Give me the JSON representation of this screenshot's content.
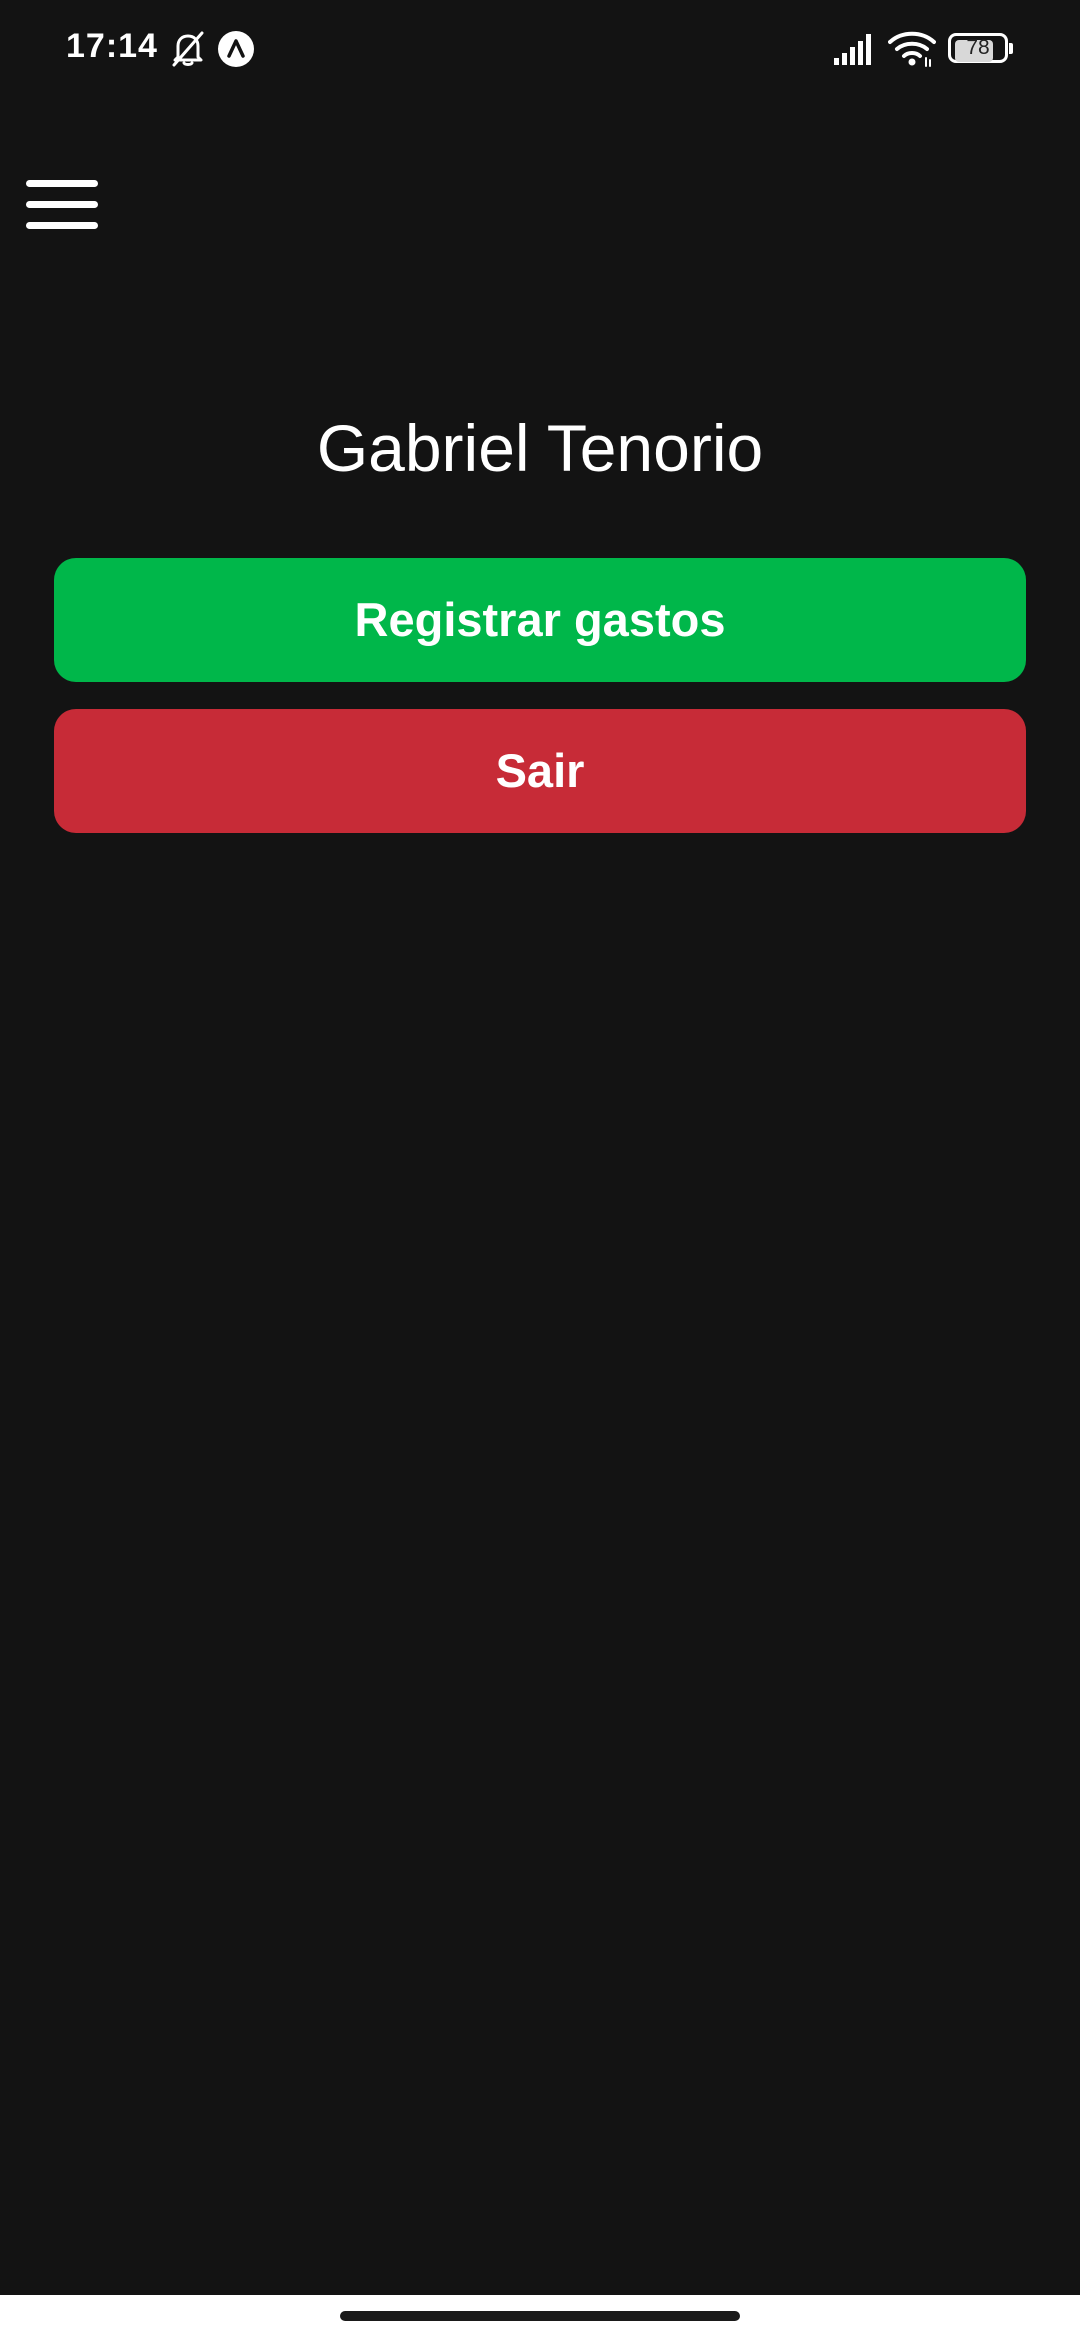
{
  "status_bar": {
    "time": "17:14",
    "battery_level": "78",
    "icons": [
      "bell-off-icon",
      "expo-icon",
      "signal-icon",
      "wifi-icon",
      "battery-icon"
    ]
  },
  "header": {
    "menu_icon": "hamburger-menu-icon"
  },
  "profile": {
    "name": "Gabriel Tenorio"
  },
  "actions": {
    "register_label": "Registrar gastos",
    "logout_label": "Sair"
  },
  "colors": {
    "background": "#131313",
    "register_button": "#00b74a",
    "logout_button": "#c72b37",
    "text": "#ffffff"
  }
}
